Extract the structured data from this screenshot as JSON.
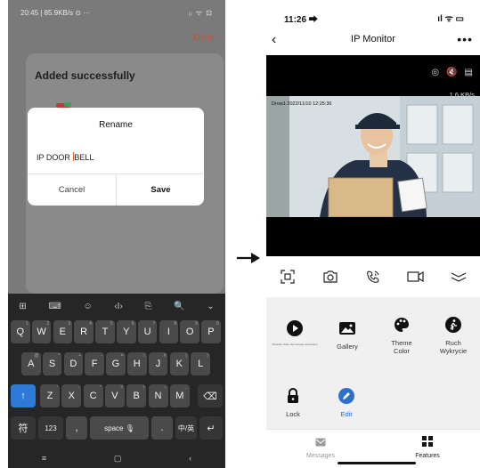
{
  "left_phone": {
    "status_time": "20:45 | 85.9KB/s ⊙ ···",
    "status_right": "ᵢᵢ ᯤ ⊡",
    "done_label": "Done",
    "added_title": "Added successfully",
    "dialog": {
      "title": "Rename",
      "field_before_caret": "IP DOOR ",
      "field_after_caret": "BELL",
      "cancel_label": "Cancel",
      "save_label": "Save"
    },
    "keyboard": {
      "toolbar": [
        "⊞",
        "⌨",
        "☺",
        "‹I›",
        "⎘",
        "🔍",
        "⌄"
      ],
      "row1": [
        {
          "k": "Q",
          "s": "1"
        },
        {
          "k": "W",
          "s": "2"
        },
        {
          "k": "E",
          "s": "3"
        },
        {
          "k": "R",
          "s": "4"
        },
        {
          "k": "T",
          "s": "5"
        },
        {
          "k": "Y",
          "s": "6"
        },
        {
          "k": "U",
          "s": "7"
        },
        {
          "k": "I",
          "s": "8"
        },
        {
          "k": "O",
          "s": "9"
        },
        {
          "k": "P",
          "s": "0"
        }
      ],
      "row2": [
        {
          "k": "A",
          "s": "@"
        },
        {
          "k": "S",
          "s": "*"
        },
        {
          "k": "D",
          "s": "+"
        },
        {
          "k": "F",
          "s": "-"
        },
        {
          "k": "G",
          "s": "="
        },
        {
          "k": "H",
          "s": "/"
        },
        {
          "k": "J",
          "s": "#"
        },
        {
          "k": "K",
          "s": "("
        },
        {
          "k": "L",
          "s": ")"
        }
      ],
      "row3": [
        {
          "k": "Z",
          "s": "'"
        },
        {
          "k": "X",
          "s": ":"
        },
        {
          "k": "C",
          "s": "\""
        },
        {
          "k": "V",
          "s": "?"
        },
        {
          "k": "B",
          "s": "!"
        },
        {
          "k": "N",
          "s": "~"
        },
        {
          "k": "M",
          "s": "…"
        }
      ],
      "shift": "↑",
      "backspace": "⌫",
      "symbols": "符",
      "numbers": "123",
      "comma": ",",
      "space": "space 🎙",
      "period": ".",
      "lang": "中/英",
      "enter": "↵",
      "nav": [
        "≡",
        "▢",
        "‹"
      ]
    }
  },
  "right_phone": {
    "status_time": "11:26 ⮕",
    "status_icons": "ıl ᯤ ▭",
    "back": "‹",
    "title": "IP Monitor",
    "more": "•••",
    "video_icons": [
      "◎",
      "🔇",
      "▤"
    ],
    "bitrate": "1.6 KB/s",
    "stamp": "Drow1 2022/11/10 12:25:36",
    "features": [
      {
        "icon": "play-icon",
        "label": "Webcam video clip storage description",
        "style": "tiny"
      },
      {
        "icon": "gallery-icon",
        "label": "Gallery"
      },
      {
        "icon": "palette-icon",
        "label": "Theme\nColor"
      },
      {
        "icon": "motion-icon",
        "label": "Ruch\nWykrycie"
      },
      {
        "icon": "lock-icon",
        "label": "Lock"
      },
      {
        "icon": "edit-icon",
        "label": "Edit",
        "style": "blue"
      }
    ],
    "tabs": [
      {
        "label": "Messages",
        "active": false
      },
      {
        "label": "Features",
        "active": true
      }
    ]
  },
  "colors": {
    "accent_blue": "#2f6fd0",
    "done_orange": "#b8563a",
    "keyboard_bg": "#262626"
  }
}
